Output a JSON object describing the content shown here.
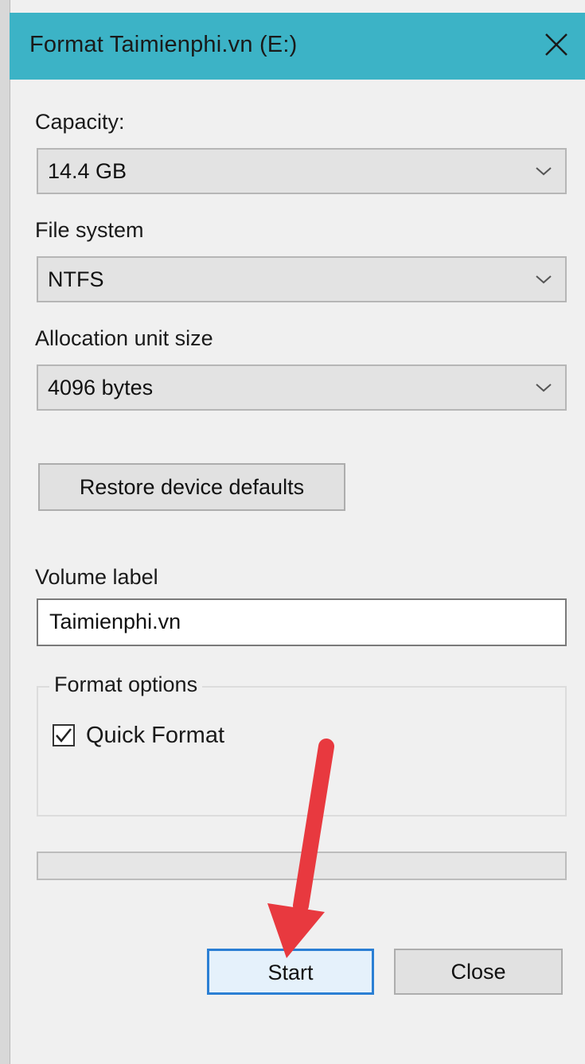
{
  "window": {
    "title": "Format Taimienphi.vn (E:)",
    "accent_color": "#3cb3c6"
  },
  "capacity": {
    "label": "Capacity:",
    "value": "14.4 GB"
  },
  "file_system": {
    "label": "File system",
    "value": "NTFS"
  },
  "allocation": {
    "label": "Allocation unit size",
    "value": "4096 bytes"
  },
  "restore_button": {
    "label": "Restore device defaults"
  },
  "volume": {
    "label": "Volume label",
    "value": "Taimienphi.vn"
  },
  "format_options": {
    "legend": "Format options",
    "quick_format_label": "Quick Format",
    "quick_format_checked": true
  },
  "progress": {
    "value": 0
  },
  "buttons": {
    "start_label": "Start",
    "close_label": "Close"
  },
  "annotation": {
    "arrow_color": "#e8393f",
    "arrow_icon": "red-pointer-arrow"
  }
}
